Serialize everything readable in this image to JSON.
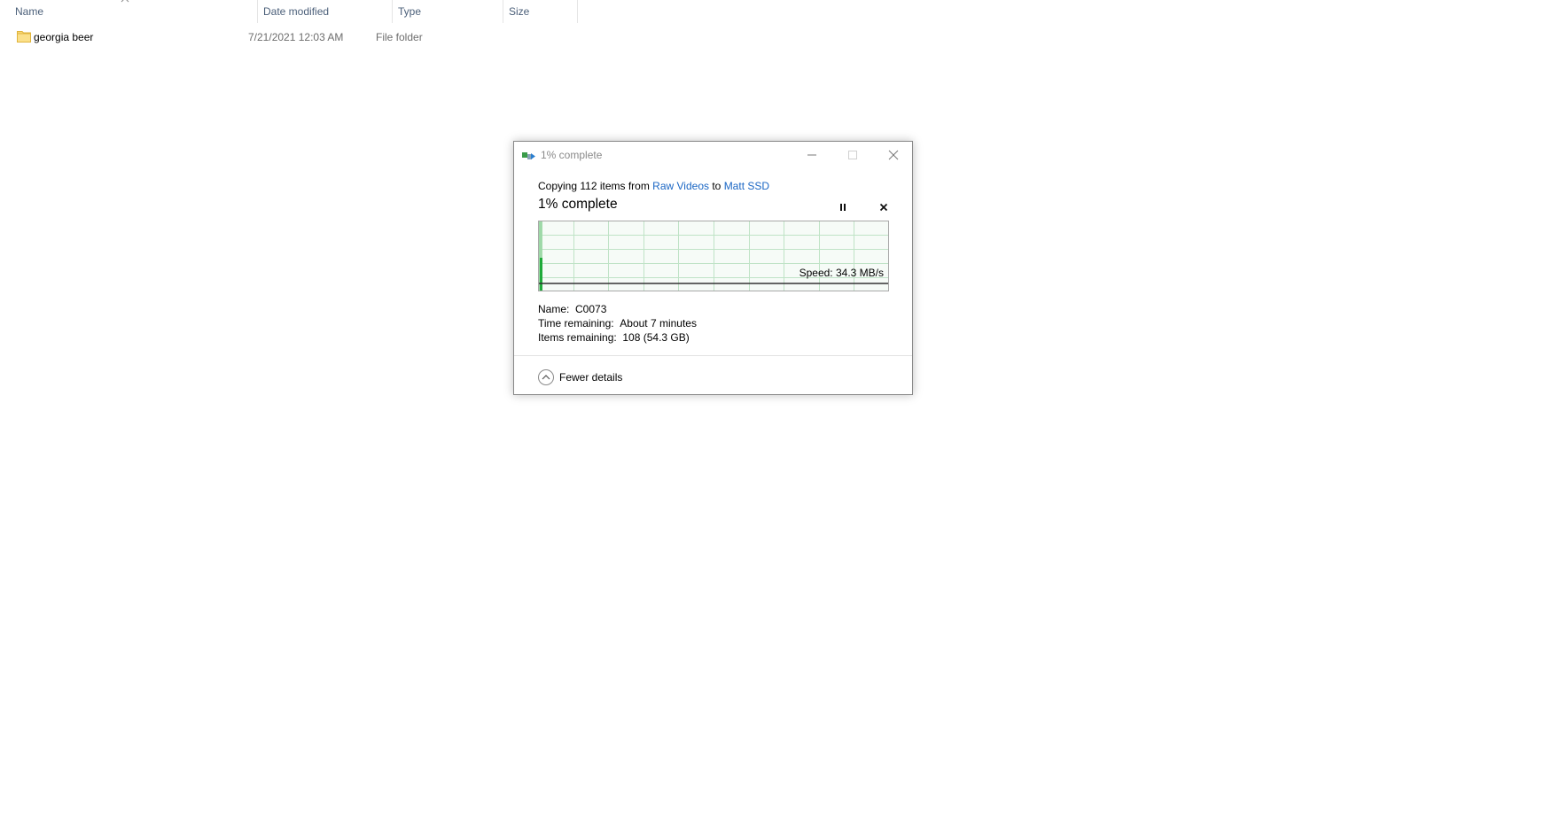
{
  "explorer": {
    "columns": [
      {
        "label": "Name"
      },
      {
        "label": "Date modified"
      },
      {
        "label": "Type"
      },
      {
        "label": "Size"
      }
    ],
    "files": [
      {
        "name": "georgia beer",
        "date_modified": "7/21/2021 12:03 AM",
        "type": "File folder",
        "size": ""
      }
    ]
  },
  "dialog": {
    "title": "1% complete",
    "copy_prefix": "Copying 112 items from ",
    "source": "Raw Videos",
    "copy_mid": " to ",
    "destination": "Matt SSD",
    "progress_title": "1% complete",
    "progress_fraction": 0.01,
    "speed_text": "Speed: 34.3 MB/s",
    "details": {
      "name_label": "Name:",
      "name_value": "C0073",
      "time_label": "Time remaining:",
      "time_value": "About 7 minutes",
      "items_label": "Items remaining:",
      "items_value": "108 (54.3 GB)"
    },
    "fewer_details_label": "Fewer details"
  },
  "colors": {
    "link": "#1a66c4",
    "graph_fill": "#e7f5e9",
    "graph_grid": "#bfe3c6",
    "graph_bar": "#1faa3a",
    "graph_bar_light": "#9ed9a8"
  }
}
